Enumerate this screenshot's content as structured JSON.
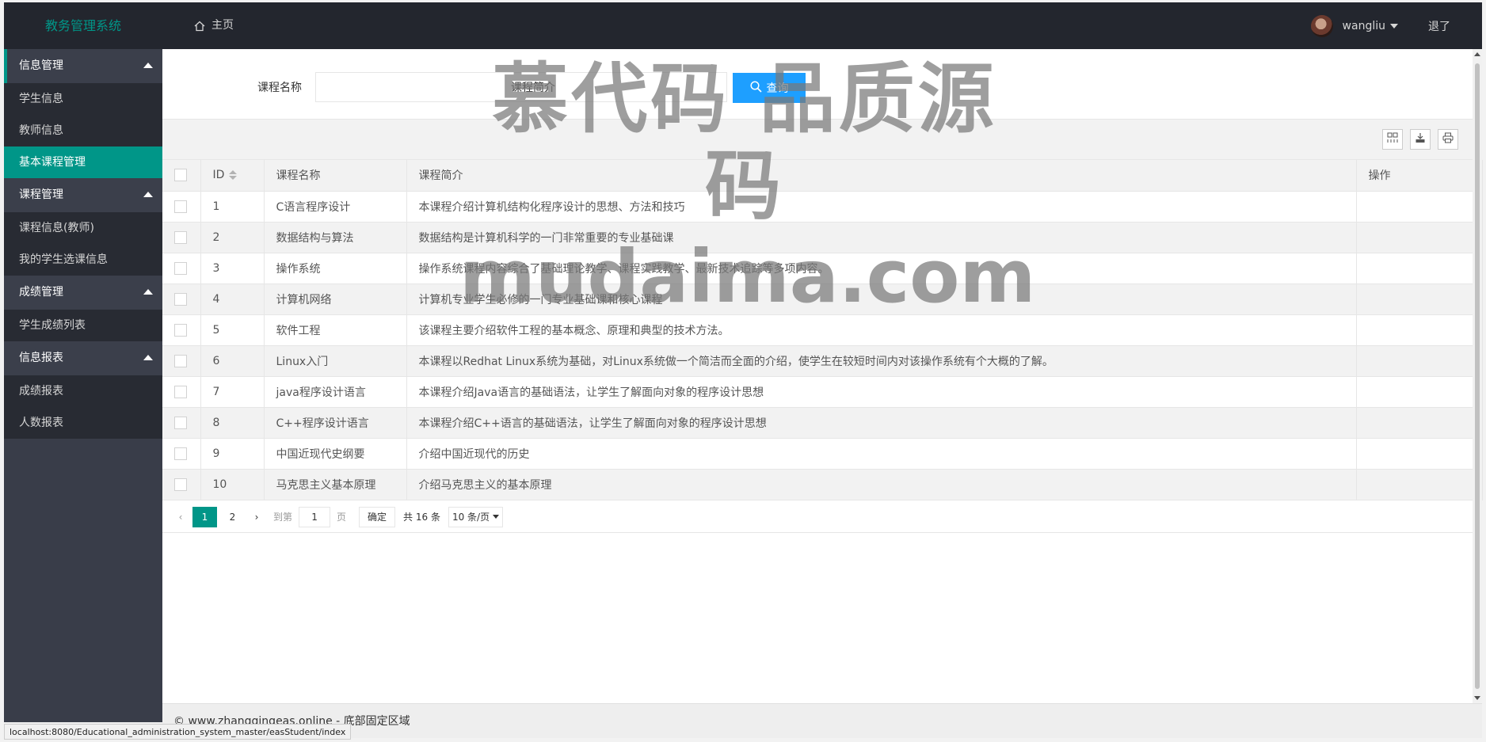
{
  "header": {
    "logo": "教务管理系统",
    "home_label": "主页",
    "username": "wangliu",
    "logout_label": "退了"
  },
  "sidebar": {
    "groups": [
      {
        "label": "信息管理",
        "children": [
          "学生信息",
          "教师信息",
          "基本课程管理"
        ]
      },
      {
        "label": "课程管理",
        "children": [
          "课程信息(教师)",
          "我的学生选课信息"
        ]
      },
      {
        "label": "成绩管理",
        "children": [
          "学生成绩列表"
        ]
      },
      {
        "label": "信息报表",
        "children": [
          "成绩报表",
          "人数报表"
        ]
      }
    ],
    "active_item": "基本课程管理"
  },
  "search": {
    "name_label": "课程名称",
    "intro_label": "课程简介",
    "button_label": "查询"
  },
  "table": {
    "headers": [
      "ID",
      "课程名称",
      "课程简介",
      "操作"
    ],
    "rows": [
      {
        "id": "1",
        "name": "C语言程序设计",
        "intro": "本课程介绍计算机结构化程序设计的思想、方法和技巧"
      },
      {
        "id": "2",
        "name": "数据结构与算法",
        "intro": "数据结构是计算机科学的一门非常重要的专业基础课"
      },
      {
        "id": "3",
        "name": "操作系统",
        "intro": "操作系统课程内容综合了基础理论教学、课程实践教学、最新技术追踪等多项内容。"
      },
      {
        "id": "4",
        "name": "计算机网络",
        "intro": "计算机专业学生必修的一门专业基础课和核心课程"
      },
      {
        "id": "5",
        "name": "软件工程",
        "intro": "该课程主要介绍软件工程的基本概念、原理和典型的技术方法。"
      },
      {
        "id": "6",
        "name": "Linux入门",
        "intro": "本课程以Redhat Linux系统为基础，对Linux系统做一个简洁而全面的介绍，使学生在较短时间内对该操作系统有个大概的了解。"
      },
      {
        "id": "7",
        "name": "java程序设计语言",
        "intro": "本课程介绍Java语言的基础语法，让学生了解面向对象的程序设计思想"
      },
      {
        "id": "8",
        "name": "C++程序设计语言",
        "intro": "本课程介绍C++语言的基础语法，让学生了解面向对象的程序设计思想"
      },
      {
        "id": "9",
        "name": "中国近现代史纲要",
        "intro": "介绍中国近现代的历史"
      },
      {
        "id": "10",
        "name": "马克思主义基本原理",
        "intro": "介绍马克思主义的基本原理"
      }
    ]
  },
  "pager": {
    "pages": [
      "1",
      "2"
    ],
    "current": "1",
    "goto_label": "到第",
    "goto_value": "1",
    "page_unit": "页",
    "confirm_label": "确定",
    "total_label": "共 16 条",
    "page_size": "10 条/页"
  },
  "footer": {
    "text": "© www.zhangqingeas.online - 底部固定区域"
  },
  "statusbar": {
    "url": "localhost:8080/Educational_administration_system_master/easStudent/index"
  },
  "watermark": {
    "line1": "慕代码 品质源码",
    "line2": "mudaima.com"
  },
  "colors": {
    "accent": "#009688",
    "header_bg": "#23262e",
    "sidebar_bg": "#393d49",
    "button_blue": "#1e9fff"
  }
}
